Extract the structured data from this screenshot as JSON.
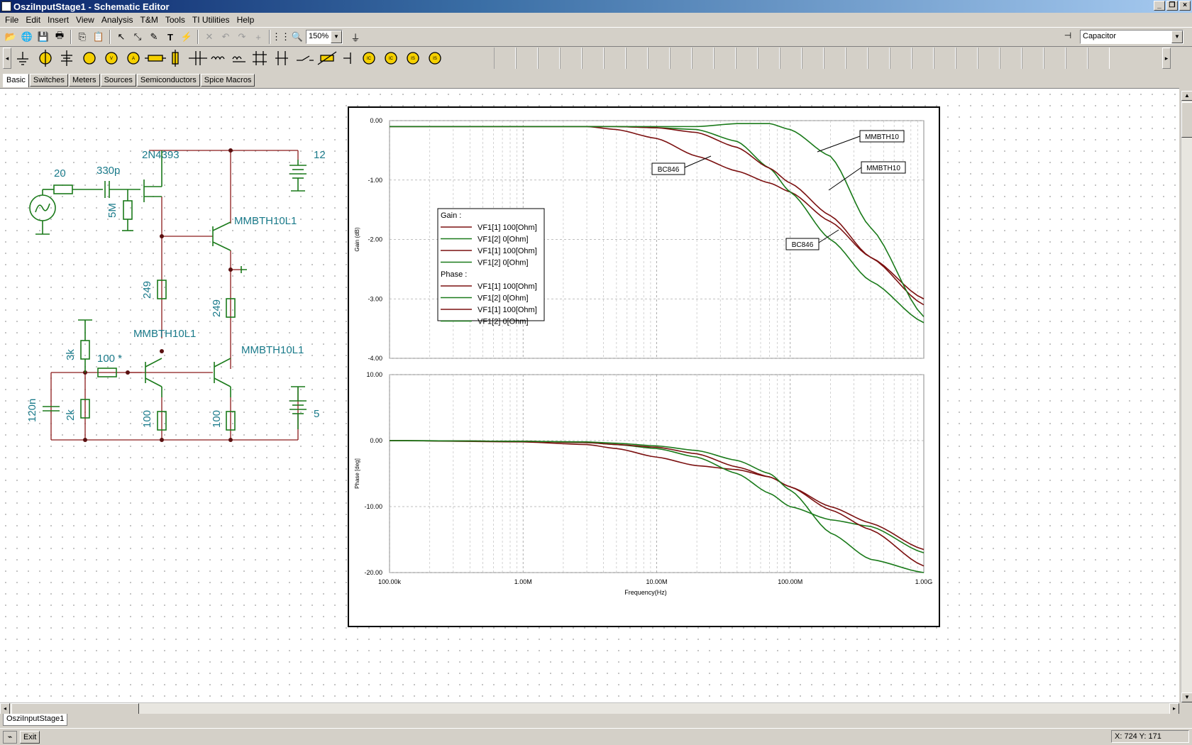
{
  "window": {
    "title": "OsziInputStage1 - Schematic Editor",
    "buttons": [
      "_",
      "❐",
      "×"
    ]
  },
  "menu": [
    "File",
    "Edit",
    "Insert",
    "View",
    "Analysis",
    "T&M",
    "Tools",
    "TI Utilities",
    "Help"
  ],
  "toolbar": {
    "zoom": "150%",
    "component_selector": "Capacitor"
  },
  "component_tabs": [
    "Basic",
    "Switches",
    "Meters",
    "Sources",
    "Semiconductors",
    "Spice Macros"
  ],
  "active_component_tab": "Basic",
  "schematic": {
    "labels": {
      "r_source": "20",
      "c_input": "330p",
      "jfet": "2N4393",
      "r_gate": "5M",
      "v_supply": "12",
      "q_upper": "MMBTH10L1",
      "r_249_left": "249",
      "r_249_right": "249",
      "q_lower_left": "MMBTH10L1",
      "q_lower_right": "MMBTH10L1",
      "r_3k": "3k",
      "r_100_star": "100 *",
      "c_120n": "120n",
      "r_2k": "2k",
      "r_100_left": "100",
      "r_100_right": "100",
      "v_bias": "5"
    }
  },
  "chart_data": [
    {
      "type": "line",
      "title": "",
      "xlabel": "",
      "ylabel": "Gain (dB)",
      "xscale": "log",
      "xlim": [
        100000,
        1000000000
      ],
      "ylim": [
        -4.0,
        0.0
      ],
      "yticks": [
        "0.00",
        "-1.00",
        "-2.00",
        "-3.00",
        "-4.00"
      ],
      "grid": true,
      "annotations": [
        "MMBTH10",
        "MMBTH10",
        "BC846",
        "BC846"
      ],
      "legend": {
        "groups": [
          {
            "header": "Gain :",
            "entries": [
              "VF1[1]  100[Ohm]",
              "VF1[2]  0[Ohm]",
              "VF1[1]  100[Ohm]",
              "VF1[2]  0[Ohm]"
            ]
          },
          {
            "header": "Phase :",
            "entries": [
              "VF1[1]  100[Ohm]",
              "VF1[2]  0[Ohm]",
              "VF1[1]  100[Ohm]",
              "VF1[2]  0[Ohm]"
            ]
          }
        ],
        "colors": [
          "#7b1010",
          "#1a7a1a",
          "#7b1010",
          "#1a7a1a"
        ]
      },
      "series": [
        {
          "x": [
            100000,
            1000000,
            3000000,
            5000000,
            10000000,
            20000000,
            40000000,
            70000000,
            100000000,
            200000000,
            400000000,
            1000000000
          ],
          "values": [
            -0.1,
            -0.1,
            -0.1,
            -0.15,
            -0.3,
            -0.6,
            -0.85,
            -1.05,
            -1.2,
            -1.7,
            -2.3,
            -3.0
          ]
        },
        {
          "x": [
            100000,
            1000000,
            3000000,
            5000000,
            10000000,
            20000000,
            40000000,
            70000000,
            100000000,
            200000000,
            400000000,
            1000000000
          ],
          "values": [
            -0.1,
            -0.1,
            -0.1,
            -0.1,
            -0.12,
            -0.15,
            -0.35,
            -0.8,
            -1.2,
            -2.0,
            -2.7,
            -3.4
          ]
        },
        {
          "x": [
            100000,
            1000000,
            3000000,
            5000000,
            10000000,
            20000000,
            40000000,
            70000000,
            100000000,
            200000000,
            400000000,
            1000000000
          ],
          "values": [
            -0.1,
            -0.1,
            -0.1,
            -0.1,
            -0.12,
            -0.2,
            -0.45,
            -0.8,
            -1.05,
            -1.6,
            -2.3,
            -3.1
          ]
        },
        {
          "x": [
            100000,
            1000000,
            3000000,
            5000000,
            10000000,
            20000000,
            40000000,
            70000000,
            100000000,
            200000000,
            400000000,
            1000000000
          ],
          "values": [
            -0.1,
            -0.1,
            -0.1,
            -0.1,
            -0.1,
            -0.1,
            -0.05,
            -0.05,
            -0.15,
            -0.6,
            -1.8,
            -3.3
          ]
        }
      ],
      "series_colors": [
        "#7b1010",
        "#1a7a1a",
        "#7b1010",
        "#1a7a1a"
      ]
    },
    {
      "type": "line",
      "title": "",
      "xlabel": "Frequency(Hz)",
      "ylabel": "Phase [deg]",
      "xscale": "log",
      "xlim": [
        100000,
        1000000000
      ],
      "ylim": [
        -20.0,
        10.0
      ],
      "xticks": [
        "100.00k",
        "1.00M",
        "10.00M",
        "100.00M",
        "1.00G"
      ],
      "yticks": [
        "10.00",
        "0.00",
        "-10.00",
        "-20.00"
      ],
      "grid": true,
      "series": [
        {
          "x": [
            100000,
            1000000,
            3000000,
            5000000,
            10000000,
            20000000,
            40000000,
            70000000,
            100000000,
            200000000,
            400000000,
            1000000000
          ],
          "values": [
            0,
            -0.2,
            -0.6,
            -1.2,
            -2.5,
            -3.8,
            -4.4,
            -5.5,
            -7.0,
            -10.0,
            -12.5,
            -16.5
          ]
        },
        {
          "x": [
            100000,
            1000000,
            3000000,
            5000000,
            10000000,
            20000000,
            40000000,
            70000000,
            100000000,
            200000000,
            400000000,
            1000000000
          ],
          "values": [
            0,
            -0.1,
            -0.3,
            -0.6,
            -1.2,
            -2.5,
            -5.0,
            -8.0,
            -10.0,
            -12.0,
            -13.0,
            -17.0
          ]
        },
        {
          "x": [
            100000,
            1000000,
            3000000,
            5000000,
            10000000,
            20000000,
            40000000,
            70000000,
            100000000,
            200000000,
            400000000,
            1000000000
          ],
          "values": [
            0,
            -0.1,
            -0.3,
            -0.6,
            -1.0,
            -2.0,
            -4.0,
            -5.5,
            -7.0,
            -10.5,
            -13.5,
            -19.0
          ]
        },
        {
          "x": [
            100000,
            1000000,
            3000000,
            5000000,
            10000000,
            20000000,
            40000000,
            70000000,
            100000000,
            200000000,
            400000000,
            1000000000
          ],
          "values": [
            0,
            -0.1,
            -0.2,
            -0.4,
            -0.8,
            -1.5,
            -3.0,
            -5.0,
            -7.5,
            -14.0,
            -18.0,
            -20.0
          ]
        }
      ],
      "series_colors": [
        "#7b1010",
        "#1a7a1a",
        "#7b1010",
        "#1a7a1a"
      ]
    }
  ],
  "document_tab": "OsziInputStage1",
  "status": {
    "exit_label": "Exit",
    "coords": "X: 724  Y: 171"
  },
  "colors": {
    "wire": "#8b1a1a",
    "component": "#1a7a1a",
    "label": "#1a7a8a",
    "brown_series": "#7b1010",
    "green_series": "#1a7a1a"
  }
}
